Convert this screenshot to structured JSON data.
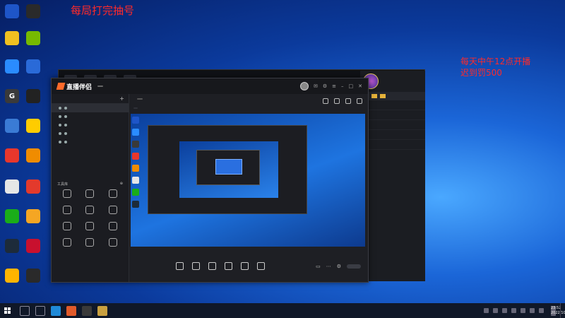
{
  "overlay": {
    "top_notice": "每局打完抽号",
    "right_notice_line1": "每天中午12点开播",
    "right_notice_line2": "迟到罚500",
    "bottom_contact": ""
  },
  "desktop_icons": [
    {
      "label": "",
      "color": "#1e55c8",
      "glyph": ""
    },
    {
      "label": "",
      "color": "#2a2a2a",
      "glyph": ""
    },
    {
      "label": "",
      "color": "#f0c020",
      "glyph": ""
    },
    {
      "label": "",
      "color": "#76b900",
      "glyph": ""
    },
    {
      "label": "",
      "color": "#2a8cff",
      "glyph": ""
    },
    {
      "label": "",
      "color": "#2a6ad8",
      "glyph": ""
    },
    {
      "label": "",
      "color": "#3a3a3a",
      "glyph": "G"
    },
    {
      "label": "",
      "color": "#222222",
      "glyph": ""
    },
    {
      "label": "",
      "color": "#3a7bd5",
      "glyph": ""
    },
    {
      "label": "",
      "color": "#ffcc00",
      "glyph": ""
    },
    {
      "label": "",
      "color": "#e8372c",
      "glyph": ""
    },
    {
      "label": "",
      "color": "#f08c00",
      "glyph": ""
    },
    {
      "label": "",
      "color": "#e6e6e6",
      "glyph": ""
    },
    {
      "label": "",
      "color": "#e33a2c",
      "glyph": ""
    },
    {
      "label": "",
      "color": "#1aad19",
      "glyph": ""
    },
    {
      "label": "",
      "color": "#f5a623",
      "glyph": ""
    },
    {
      "label": "",
      "color": "#1d2b3a",
      "glyph": ""
    },
    {
      "label": "",
      "color": "#c8102e",
      "glyph": ""
    },
    {
      "label": "",
      "color": "#ffb400",
      "glyph": ""
    },
    {
      "label": "",
      "color": "#2a2a2a",
      "glyph": ""
    },
    {
      "label": "",
      "color": "#07c160",
      "glyph": ""
    },
    {
      "label": "",
      "color": "#0a0a5a",
      "glyph": ""
    },
    {
      "label": "",
      "color": "#f6c000",
      "glyph": ""
    }
  ],
  "app": {
    "name": "直播伴侣",
    "version": "",
    "left_tabs": [
      "",
      "",
      ""
    ],
    "scenes": [
      {
        "label": "",
        "active": true
      },
      {
        "label": "",
        "active": false
      },
      {
        "label": "",
        "active": false
      },
      {
        "label": "",
        "active": false
      },
      {
        "label": "",
        "active": false
      }
    ],
    "tools_title": "工具库",
    "tools": [
      "",
      "",
      "",
      "",
      "",
      "",
      "",
      "",
      "",
      "",
      "",
      ""
    ],
    "room_title": "",
    "edit_label": "",
    "room_meta": {
      "tag": "",
      "fans": "",
      "id_label": "",
      "id": "",
      "count": ""
    },
    "bottom_tools": [
      "",
      "",
      "",
      "",
      "",
      ""
    ],
    "start_button": "",
    "status_items": [
      "",
      "",
      "",
      ""
    ]
  },
  "side_panel": {
    "name": "",
    "status": "",
    "rows": [
      "",
      "",
      "",
      "",
      ""
    ]
  },
  "taskbar": {
    "time": "23:52",
    "date": "2022/10/18"
  }
}
